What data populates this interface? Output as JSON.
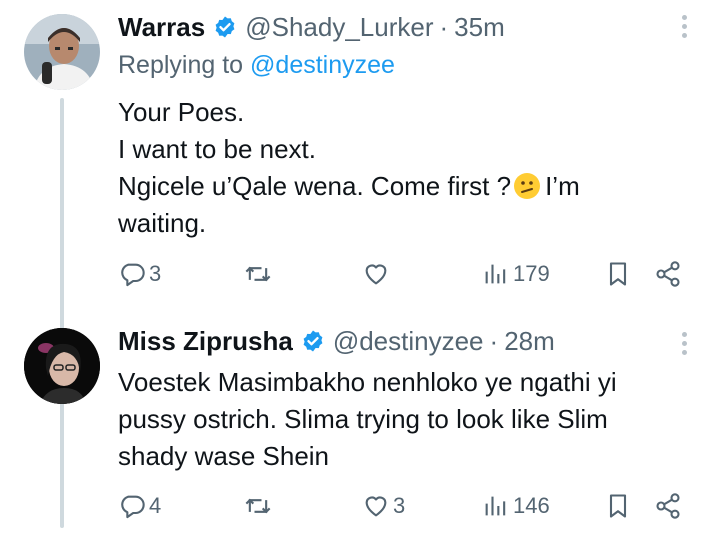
{
  "tweets": [
    {
      "name": "Warras",
      "handle": "@Shady_Lurker",
      "separator": "·",
      "time": "35m",
      "reply_prefix": "Replying to",
      "reply_mention": "@destinyzee",
      "lines": [
        "Your Poes.",
        "I want to be next.",
        "Ngicele u’Qale wena. Come first ?",
        "I’m",
        "waiting."
      ],
      "emoji": "confused-face",
      "replies": "3",
      "retweets": "",
      "likes": "",
      "views": "179"
    },
    {
      "name": "Miss Ziprusha",
      "handle": "@destinyzee",
      "separator": "·",
      "time": "28m",
      "lines": [
        "Voestek Masimbakho nenhloko ye ngathi yi",
        "pussy ostrich. Slima trying to look like Slim",
        "shady wase Shein"
      ],
      "replies": "4",
      "retweets": "",
      "likes": "3",
      "views": "146"
    }
  ],
  "icons": {
    "verified": "verified-badge-icon",
    "reply": "reply-icon",
    "retweet": "retweet-icon",
    "like": "heart-icon",
    "views": "views-icon",
    "bookmark": "bookmark-icon",
    "share": "share-icon",
    "more": "more-icon"
  },
  "colors": {
    "verified": "#1d9bf0",
    "muted": "#536471",
    "link": "#1d9bf0",
    "thread_line": "#cfd9de"
  }
}
